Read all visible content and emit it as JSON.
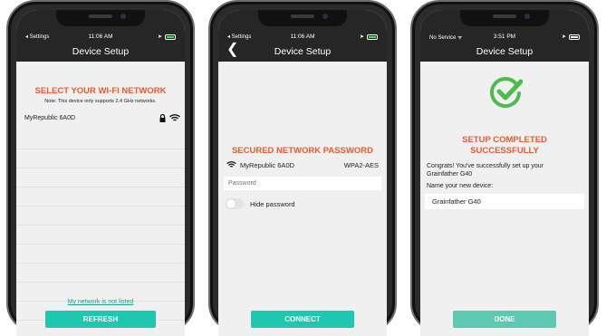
{
  "screen1": {
    "status_left": "◂ Settings",
    "time": "11:06 AM",
    "title": "Device Setup",
    "heading": "SELECT YOUR WI-FI NETWORK",
    "note": "Note: This device only supports 2.4 GHz networks.",
    "network_name": "MyRepublic 6A0D",
    "lock_icon": "lock-icon",
    "wifi_icon": "wifi-icon",
    "not_listed_link": "My network is not listed",
    "refresh_label": "REFRESH"
  },
  "screen2": {
    "status_left": "◂ Settings",
    "time": "11:06 AM",
    "title": "Device Setup",
    "heading": "SECURED NETWORK PASSWORD",
    "network_name": "MyRepublic 6A0D",
    "security": "WPA2-AES",
    "password_placeholder": "Password",
    "hide_password_label": "Hide password",
    "connect_label": "CONNECT"
  },
  "screen3": {
    "status_left": "No Service",
    "time": "3:51 PM",
    "title": "Device Setup",
    "heading_line1": "SETUP COMPLETED",
    "heading_line2": "SUCCESSFULLY",
    "congrats": "Congrats! You've successfully set up your Grainfather G40",
    "name_label": "Name your new device:",
    "device_name": "Grainfather G40",
    "done_label": "DONE"
  },
  "colors": {
    "accent_orange": "#f15a29",
    "teal": "#1ec8ae",
    "teal_dim": "#5cc9b1",
    "success_green": "#4cbc4c"
  }
}
